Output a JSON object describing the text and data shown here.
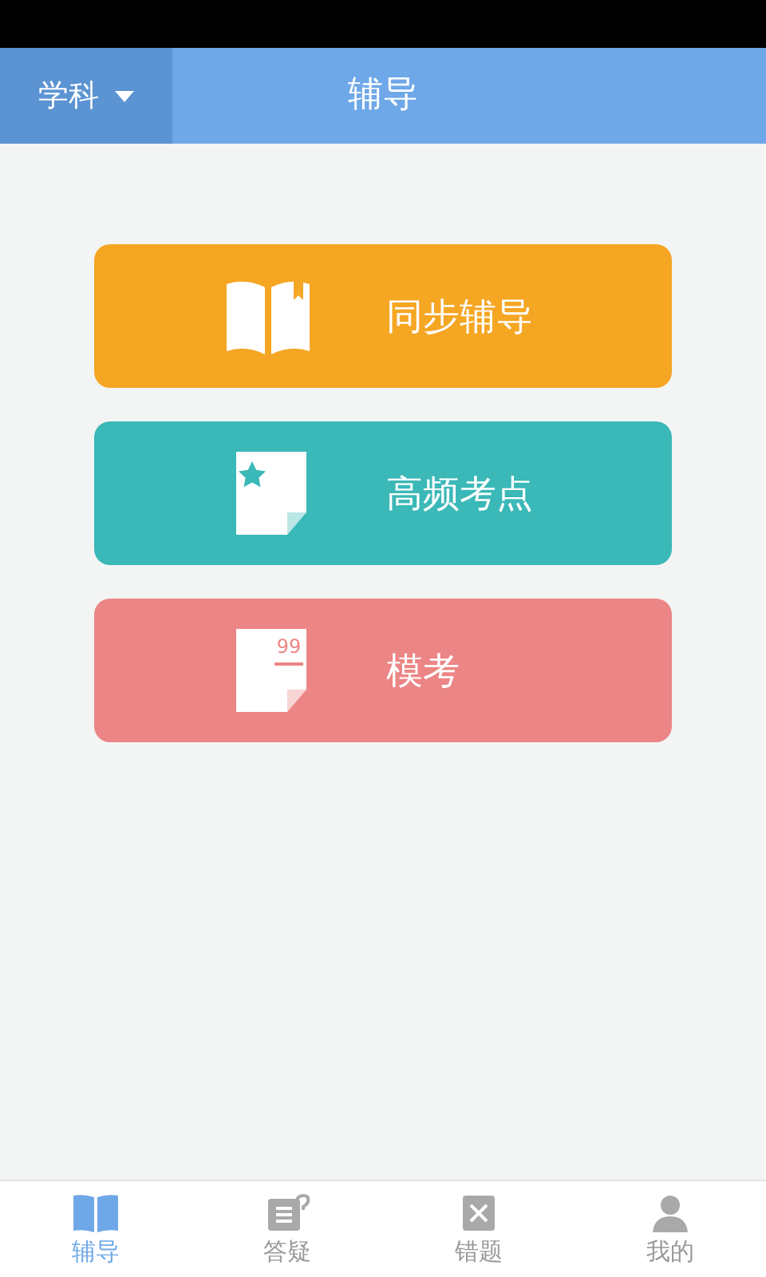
{
  "header": {
    "subject_button": "学科",
    "title": "辅导"
  },
  "cards": [
    {
      "kind": "book",
      "label": "同步辅导",
      "color": "#f5a623"
    },
    {
      "kind": "star",
      "label": "高频考点",
      "color": "#3bb8b8"
    },
    {
      "kind": "score",
      "label": "模考",
      "color": "#ec8585",
      "icon_text": "99"
    }
  ],
  "bottom_tabs": [
    {
      "kind": "book",
      "label": "辅导",
      "selected": true
    },
    {
      "kind": "question",
      "label": "答疑",
      "selected": false
    },
    {
      "kind": "mistake",
      "label": "错题",
      "selected": false
    },
    {
      "kind": "person",
      "label": "我的",
      "selected": false
    }
  ]
}
